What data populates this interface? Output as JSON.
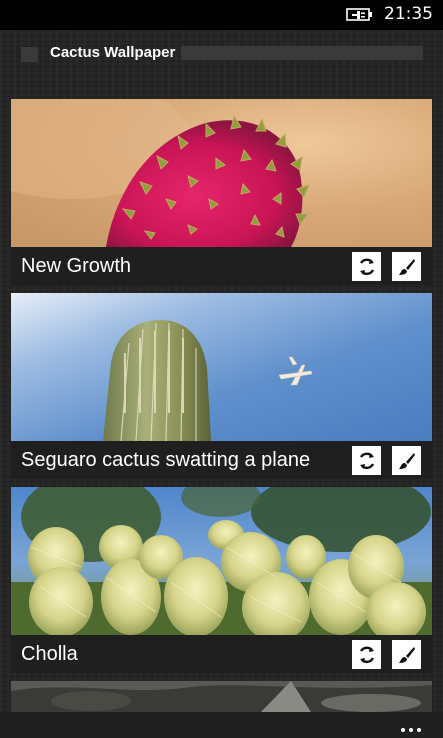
{
  "status_bar": {
    "time": "21:35",
    "battery_icon": "battery-charging-icon"
  },
  "app": {
    "title": "Cactus Wallpaper"
  },
  "cards": [
    {
      "caption": "New Growth",
      "photo": "pink-prickly-pear-pad",
      "actions": [
        "refresh-icon",
        "brush-icon"
      ]
    },
    {
      "caption": "Seguaro cactus swatting a plane",
      "photo": "saguaro-and-plane",
      "actions": [
        "refresh-icon",
        "brush-icon"
      ]
    },
    {
      "caption": "Cholla",
      "photo": "cholla-cactus",
      "actions": [
        "refresh-icon",
        "brush-icon"
      ]
    }
  ],
  "app_bar": {
    "more_icon": "ellipsis-icon"
  },
  "colors": {
    "accent": "#ffffff",
    "bar": "#1f1f1f",
    "background": "#252525"
  }
}
